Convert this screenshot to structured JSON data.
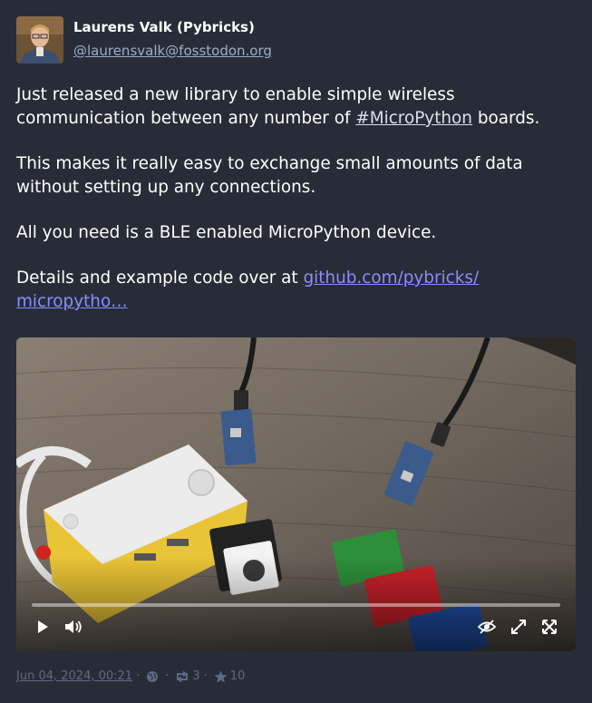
{
  "post": {
    "author_name": "Laurens Valk (Pybricks)",
    "author_handle": "@laurensvalk@fosstodon.org",
    "paragraph1_before": "Just released a new library to enable simple wireless communication between any number of ",
    "hashtag_hash": "#",
    "hashtag_label": "MicroPython",
    "paragraph1_after": " boards.",
    "paragraph2": "This makes it really easy to exchange small amounts of data without setting up any connections.",
    "paragraph3": "All you need is a BLE enabled MicroPython device.",
    "paragraph4_before": "Details and example code over at ",
    "link_text": "github.com/pybricks/ micropytho…",
    "timestamp": "Jun 04, 2024, 00:21",
    "boosts": "3",
    "favourites": "10",
    "visibility_icon": "globe-icon"
  },
  "video_player": {
    "progress": 0.0,
    "controls": [
      "play-icon",
      "volume-icon",
      "hide-media-icon",
      "expand-icon",
      "fullscreen-icon"
    ]
  },
  "colors": {
    "background": "#282c37",
    "link": "#8c8dff",
    "muted": "#606984",
    "handle": "#9baec8"
  }
}
